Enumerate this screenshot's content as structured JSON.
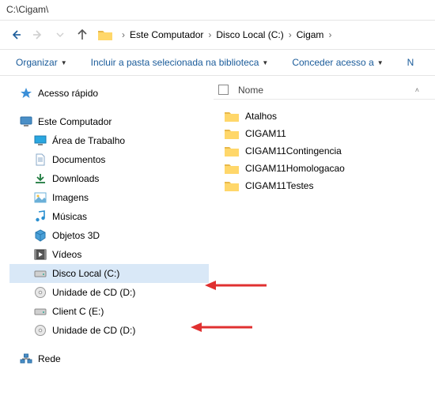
{
  "window": {
    "title": "C:\\Cigam\\"
  },
  "nav": {
    "crumbs": [
      "Este Computador",
      "Disco Local (C:)",
      "Cigam"
    ]
  },
  "toolbar": {
    "organize": "Organizar",
    "include": "Incluir a pasta selecionada na biblioteca",
    "grant": "Conceder acesso a",
    "new": "N"
  },
  "sidebar": {
    "quick": "Acesso rápido",
    "computer": "Este Computador",
    "items": [
      {
        "label": "Área de Trabalho",
        "icon": "desktop"
      },
      {
        "label": "Documentos",
        "icon": "documents"
      },
      {
        "label": "Downloads",
        "icon": "downloads"
      },
      {
        "label": "Imagens",
        "icon": "images"
      },
      {
        "label": "Músicas",
        "icon": "music"
      },
      {
        "label": "Objetos 3D",
        "icon": "objects3d"
      },
      {
        "label": "Vídeos",
        "icon": "videos"
      },
      {
        "label": "Disco Local (C:)",
        "icon": "drive"
      },
      {
        "label": "Unidade de CD (D:)",
        "icon": "cd"
      },
      {
        "label": "Client C (E:)",
        "icon": "drive"
      },
      {
        "label": "Unidade de CD (D:)",
        "icon": "cd"
      }
    ],
    "network": "Rede"
  },
  "columns": {
    "name": "Nome"
  },
  "files": [
    {
      "label": "Atalhos"
    },
    {
      "label": "CIGAM11"
    },
    {
      "label": "CIGAM11Contingencia"
    },
    {
      "label": "CIGAM11Homologacao"
    },
    {
      "label": "CIGAM11Testes"
    }
  ]
}
